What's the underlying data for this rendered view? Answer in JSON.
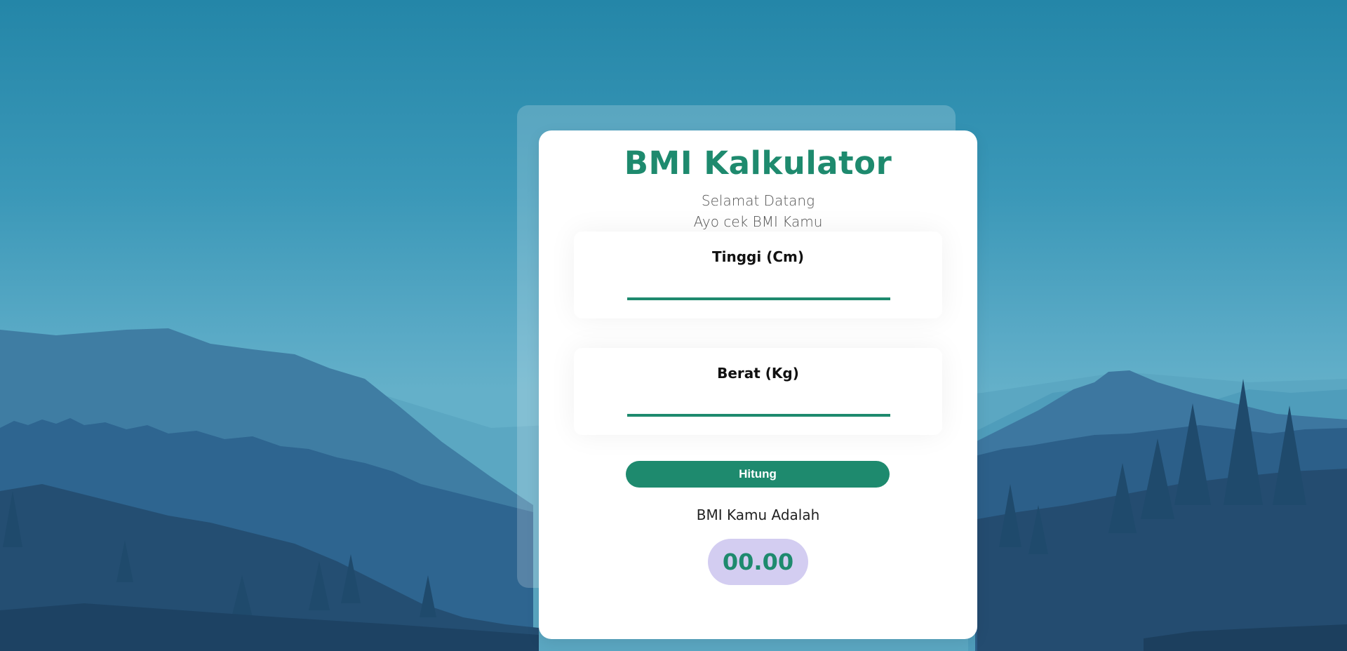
{
  "app": {
    "title": "BMI Kalkulator",
    "greeting_line1": "Selamat Datang",
    "greeting_line2": "Ayo cek BMI Kamu"
  },
  "form": {
    "height_label": "Tinggi (Cm)",
    "height_value": "",
    "weight_label": "Berat (Kg)",
    "weight_value": "",
    "submit_label": "Hitung"
  },
  "result": {
    "label": "BMI Kamu Adalah",
    "value": "00.00"
  },
  "colors": {
    "accent": "#1e8a6e",
    "result_badge": "#d3cdf1",
    "sky_top": "#2486a8",
    "sky_bottom": "#64b0c9"
  }
}
